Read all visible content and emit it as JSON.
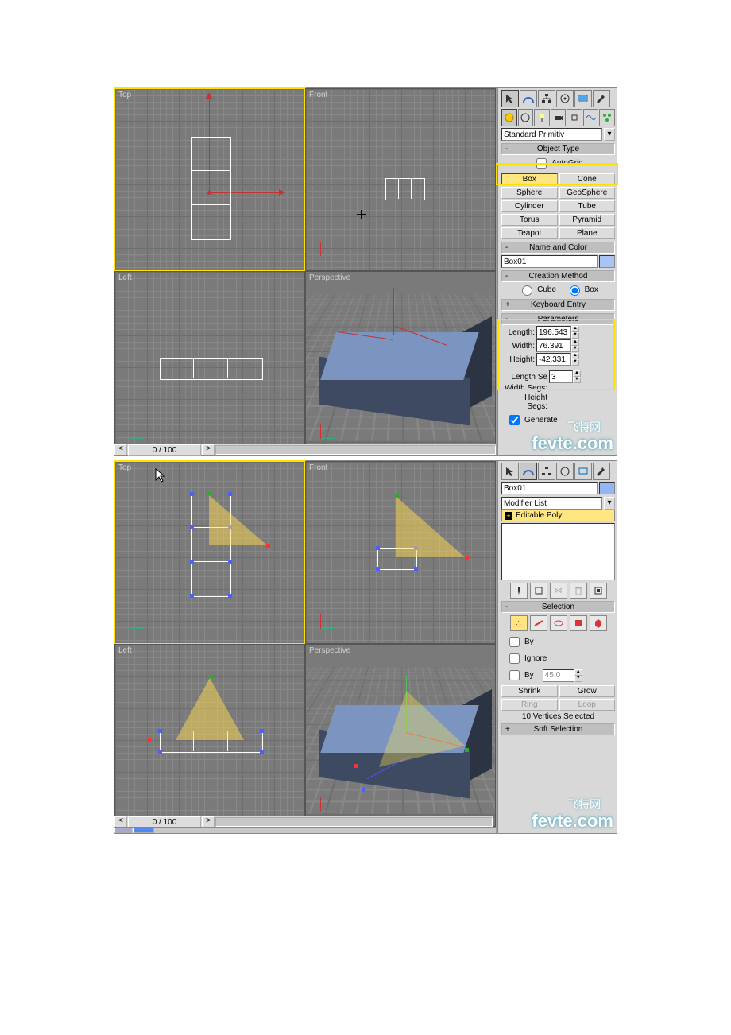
{
  "screenshot1": {
    "viewports": {
      "top": "Top",
      "front": "Front",
      "left": "Left",
      "persp": "Perspective"
    },
    "frame_display": "0 / 100",
    "panel": {
      "primitive_dropdown": "Standard Primitiv",
      "rollouts": {
        "object_type": "Object Type",
        "autogrid": "AutoGrid",
        "name_color": "Name and Color",
        "creation_method": "Creation Method",
        "keyboard_entry": "Keyboard Entry",
        "parameters": "Parameters"
      },
      "primitives": {
        "box": "Box",
        "cone": "Cone",
        "sphere": "Sphere",
        "geosphere": "GeoSphere",
        "cylinder": "Cylinder",
        "tube": "Tube",
        "torus": "Torus",
        "pyramid": "Pyramid",
        "teapot": "Teapot",
        "plane": "Plane"
      },
      "object_name": "Box01",
      "creation": {
        "cube": "Cube",
        "box": "Box"
      },
      "params": {
        "length_label": "Length:",
        "length": "196.543",
        "width_label": "Width:",
        "width": "76.391",
        "height_label": "Height:",
        "height": "-42.331",
        "lsegs_label": "Length Se",
        "lsegs": "3",
        "wsegs_label": "Width Segs:",
        "hsegs_label": "Height Segs:",
        "generate": "Generate"
      }
    },
    "watermark": "fevte.com",
    "watermark_cn": "飞特网"
  },
  "screenshot2": {
    "viewports": {
      "top": "Top",
      "front": "Front",
      "left": "Left",
      "persp": "Perspective"
    },
    "frame_display": "0 / 100",
    "panel": {
      "object_name": "Box01",
      "modifier_list": "Modifier List",
      "stack_item": "Editable Poly",
      "rollouts": {
        "selection": "Selection",
        "soft_selection": "Soft Selection"
      },
      "sel": {
        "by1": "By",
        "ignore": "Ignore",
        "by2": "By",
        "angle": "45.0",
        "shrink": "Shrink",
        "grow": "Grow",
        "ring": "Ring",
        "loop": "Loop",
        "status": "10 Vertices Selected"
      }
    },
    "watermark": "fevte.com",
    "watermark_cn": "飞特网"
  }
}
